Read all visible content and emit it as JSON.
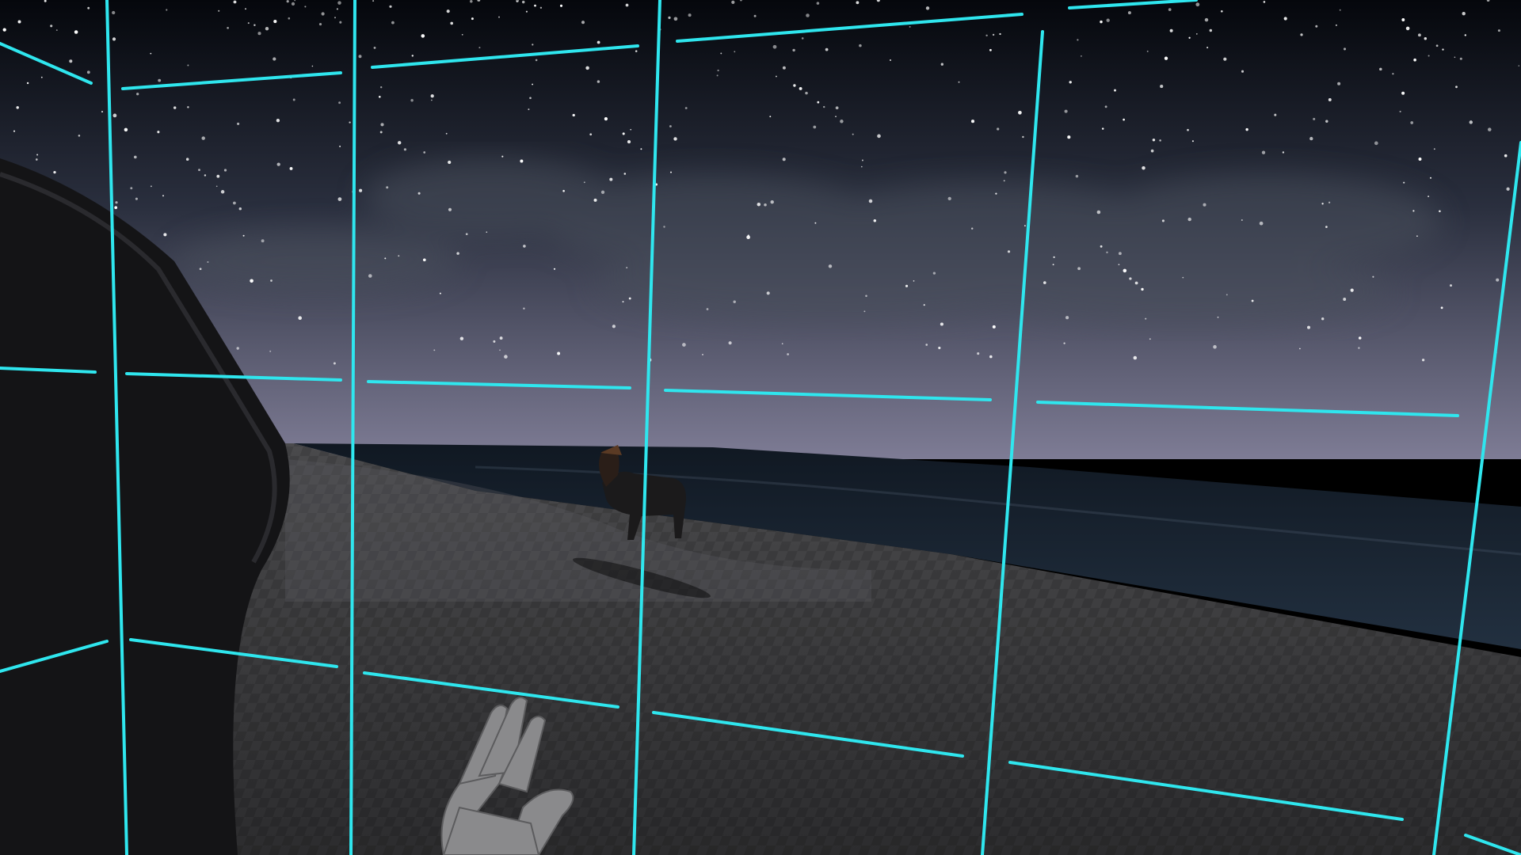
{
  "scene": {
    "view": "vr-first-person",
    "environment": "night-beach",
    "sky": {
      "top_color": "#05070c",
      "mid_color": "#2a2f3e",
      "horizon_color": "#7e7c95",
      "clouds_color": "#4a4f5c",
      "star_color": "#ffffff"
    },
    "ocean_color": "#182432",
    "sand_color": "#3a3a3c",
    "checker_dark": "#303032",
    "rock_color": "#141416",
    "guardian_boundary": {
      "visible": true,
      "color": "#2fe6ee"
    },
    "hand": {
      "side": "left",
      "color": "#8a8a8c",
      "icon": "vr-hand-icon"
    },
    "creature": {
      "type": "horse",
      "color": "#1b1a1b"
    }
  }
}
